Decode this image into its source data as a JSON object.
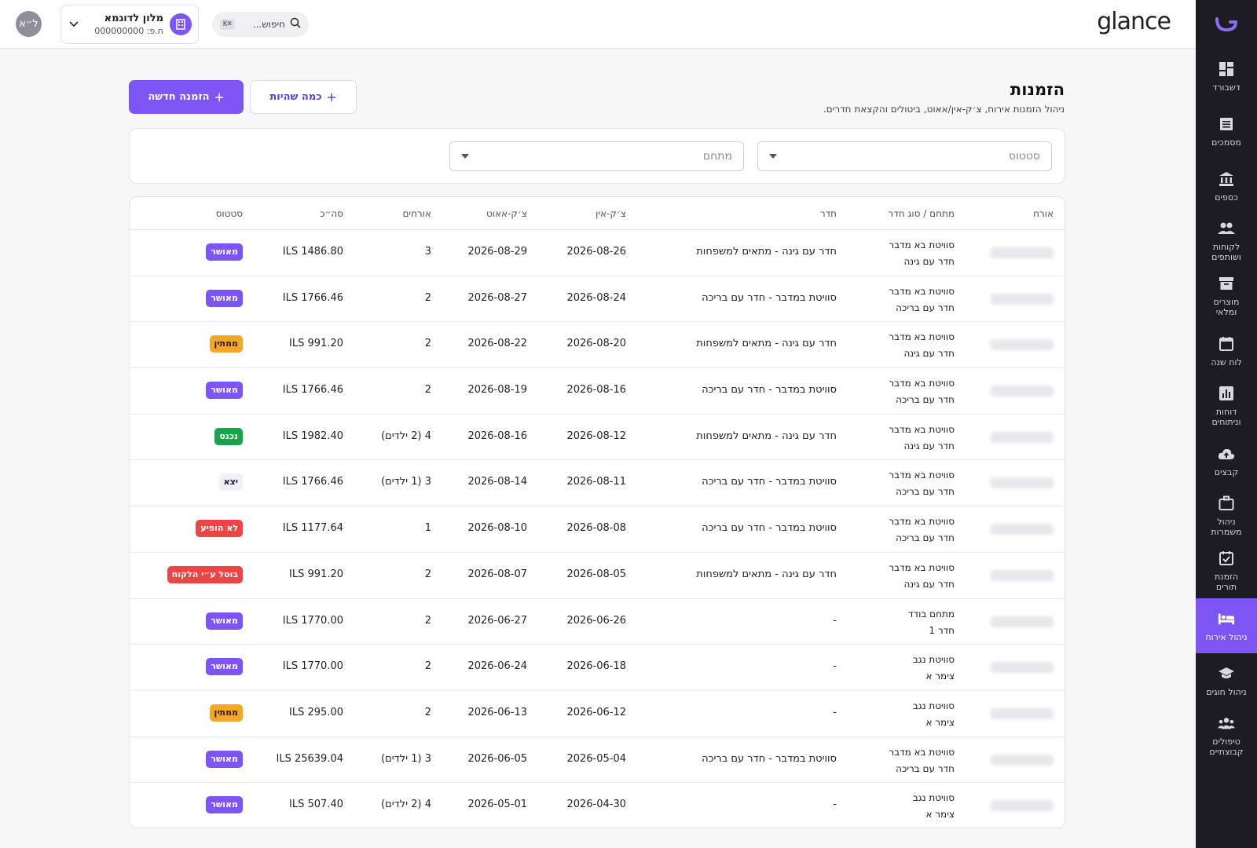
{
  "sidebar": {
    "items": [
      {
        "label": "דשבורד",
        "icon": "dashboard-icon"
      },
      {
        "label": "מסמכים",
        "icon": "documents-icon"
      },
      {
        "label": "כספים",
        "icon": "bank-icon"
      },
      {
        "label": "לקוחות\nושותפים",
        "icon": "people-icon"
      },
      {
        "label": "מוצרים\nומלאי",
        "icon": "archive-icon"
      },
      {
        "label": "לוח שנה",
        "icon": "calendar-icon"
      },
      {
        "label": "דוחות\nוניתוחים",
        "icon": "reports-icon"
      },
      {
        "label": "קבצים",
        "icon": "cloud-upload-icon"
      },
      {
        "label": "ניהול\nמשמרות",
        "icon": "briefcase-icon"
      },
      {
        "label": "הזמנת\nתורים",
        "icon": "calendar-check-icon"
      },
      {
        "label": "ניהול אירוח",
        "icon": "bed-icon",
        "active": true
      },
      {
        "label": "ניהול חוגים",
        "icon": "graduation-icon"
      },
      {
        "label": "טיפולים\nקבוצתיים",
        "icon": "group-icon"
      }
    ]
  },
  "topbar": {
    "brand": "glance",
    "avatar": "ל״א",
    "hotel_name": "מלון לדוגמא",
    "hotel_id": "ח.פ: 000000000",
    "search_placeholder": "חיפוש...",
    "search_shortcut": "⌘K"
  },
  "header": {
    "title": "הזמנות",
    "subtitle": "ניהול הזמנות אירוח, צ׳ק-אין/אאוט, ביטולים והקצאת חדרים.",
    "new_booking": "הזמנה חדשה",
    "multi_stay": "כמה שהיות"
  },
  "filters": {
    "status_placeholder": "סטטוס",
    "property_placeholder": "מתחם"
  },
  "table": {
    "headers": {
      "guest": "אורח",
      "property": "מתחם / סוג חדר",
      "room": "חדר",
      "checkin": "צ׳ק-אין",
      "checkout": "צ׳ק-אאוט",
      "guests": "אורחים",
      "total": "סה״כ",
      "status": "סטטוס"
    },
    "rows": [
      {
        "prop1": "סוויטת בא מדבר",
        "prop2": "חדר עם גינה",
        "room": "חדר עם גינה - מתאים למשפחות",
        "checkin": "2026-08-26",
        "checkout": "2026-08-29",
        "guests": "3",
        "total": "ILS 1486.80",
        "status": "מאושר",
        "status_color": "#7c55f3",
        "status_text": "#ffffff"
      },
      {
        "prop1": "סוויטת בא מדבר",
        "prop2": "חדר עם בריכה",
        "room": "סוויטת במדבר - חדר עם בריכה",
        "checkin": "2026-08-24",
        "checkout": "2026-08-27",
        "guests": "2",
        "total": "ILS 1766.46",
        "status": "מאושר",
        "status_color": "#7c55f3",
        "status_text": "#ffffff"
      },
      {
        "prop1": "סוויטת בא מדבר",
        "prop2": "חדר עם גינה",
        "room": "חדר עם גינה - מתאים למשפחות",
        "checkin": "2026-08-20",
        "checkout": "2026-08-22",
        "guests": "2",
        "total": "ILS 991.20",
        "status": "ממתין",
        "status_color": "#f5a623",
        "status_text": "#2a1a00"
      },
      {
        "prop1": "סוויטת בא מדבר",
        "prop2": "חדר עם בריכה",
        "room": "סוויטת במדבר - חדר עם בריכה",
        "checkin": "2026-08-16",
        "checkout": "2026-08-19",
        "guests": "2",
        "total": "ILS 1766.46",
        "status": "מאושר",
        "status_color": "#7c55f3",
        "status_text": "#ffffff"
      },
      {
        "prop1": "סוויטת בא מדבר",
        "prop2": "חדר עם גינה",
        "room": "חדר עם גינה - מתאים למשפחות",
        "checkin": "2026-08-12",
        "checkout": "2026-08-16",
        "guests": "4 (2 ילדים)",
        "total": "ILS 1982.40",
        "status": "נכנס",
        "status_color": "#16a34a",
        "status_text": "#ffffff"
      },
      {
        "prop1": "סוויטת בא מדבר",
        "prop2": "חדר עם בריכה",
        "room": "סוויטת במדבר - חדר עם בריכה",
        "checkin": "2026-08-11",
        "checkout": "2026-08-14",
        "guests": "3 (1 ילדים)",
        "total": "ILS 1766.46",
        "status": "יצא",
        "status_color": "#f2f0ff",
        "status_text": "#222222"
      },
      {
        "prop1": "סוויטת בא מדבר",
        "prop2": "חדר עם בריכה",
        "room": "סוויטת במדבר - חדר עם בריכה",
        "checkin": "2026-08-08",
        "checkout": "2026-08-10",
        "guests": "1",
        "total": "ILS 1177.64",
        "status": "לא הופיע",
        "status_color": "#ef4444",
        "status_text": "#ffffff"
      },
      {
        "prop1": "סוויטת בא מדבר",
        "prop2": "חדר עם גינה",
        "room": "חדר עם גינה - מתאים למשפחות",
        "checkin": "2026-08-05",
        "checkout": "2026-08-07",
        "guests": "2",
        "total": "ILS 991.20",
        "status": "בוטל ע״י הלקוח",
        "status_color": "#ef4444",
        "status_text": "#ffffff"
      },
      {
        "prop1": "מתחם בודד",
        "prop2": "חדר 1",
        "room": "-",
        "checkin": "2026-06-26",
        "checkout": "2026-06-27",
        "guests": "2",
        "total": "ILS 1770.00",
        "status": "מאושר",
        "status_color": "#7c55f3",
        "status_text": "#ffffff"
      },
      {
        "prop1": "סוויטת נגב",
        "prop2": "צימר א",
        "room": "-",
        "checkin": "2026-06-18",
        "checkout": "2026-06-24",
        "guests": "2",
        "total": "ILS 1770.00",
        "status": "מאושר",
        "status_color": "#7c55f3",
        "status_text": "#ffffff"
      },
      {
        "prop1": "סוויטת נגב",
        "prop2": "צימר א",
        "room": "-",
        "checkin": "2026-06-12",
        "checkout": "2026-06-13",
        "guests": "2",
        "total": "ILS 295.00",
        "status": "ממתין",
        "status_color": "#f5a623",
        "status_text": "#2a1a00"
      },
      {
        "prop1": "סוויטת בא מדבר",
        "prop2": "חדר עם בריכה",
        "room": "סוויטת במדבר - חדר עם בריכה",
        "checkin": "2026-05-04",
        "checkout": "2026-06-05",
        "guests": "3 (1 ילדים)",
        "total": "ILS 25639.04",
        "status": "מאושר",
        "status_color": "#7c55f3",
        "status_text": "#ffffff"
      },
      {
        "prop1": "סוויטת נגב",
        "prop2": "צימר א",
        "room": "-",
        "checkin": "2026-04-30",
        "checkout": "2026-05-01",
        "guests": "4 (2 ילדים)",
        "total": "ILS 507.40",
        "status": "מאושר",
        "status_color": "#7c55f3",
        "status_text": "#ffffff"
      }
    ]
  }
}
